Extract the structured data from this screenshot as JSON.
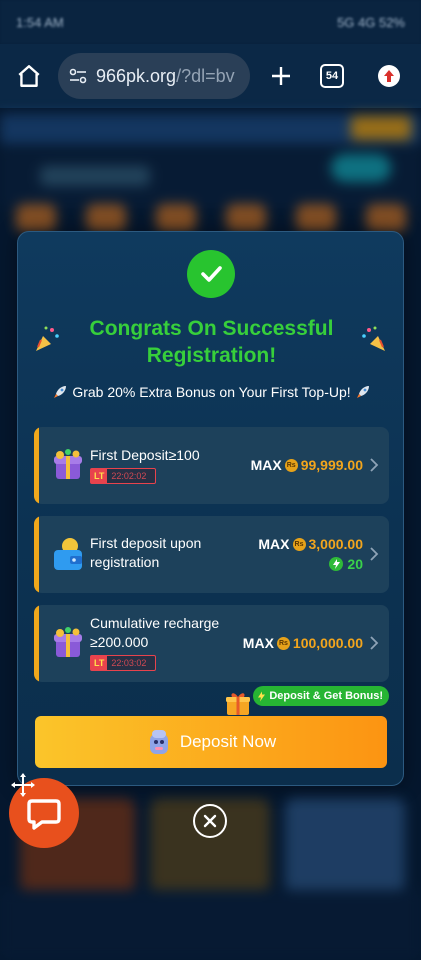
{
  "status_bar": {
    "time": "1:54 AM",
    "right": "5G 4G 52%"
  },
  "browser": {
    "url_main": "966pk.org",
    "url_rest": "/?dl=bv",
    "tab_count": "54"
  },
  "modal": {
    "title": "Congrats On Successful Registration!",
    "subtitle": "Grab 20% Extra Bonus on Your First Top-Up!",
    "offers": [
      {
        "title": "First Deposit≥100",
        "lt_label": "LT",
        "timer": "22:02:02",
        "max_label": "MAX",
        "currency": "Rs",
        "max_value": "99,999.00"
      },
      {
        "title_line1": "First deposit upon",
        "title_line2": "registration",
        "max_label": "MAX",
        "currency": "Rs",
        "max_value": "3,000.00",
        "bonus_value": "20"
      },
      {
        "title_line1": "Cumulative recharge",
        "title_line2": "≥200.000",
        "lt_label": "LT",
        "timer": "22:03:02",
        "max_label": "MAX",
        "currency": "Rs",
        "max_value": "100,000.00"
      }
    ],
    "deposit_tag": "Deposit & Get Bonus!",
    "deposit_button": "Deposit Now"
  },
  "colors": {
    "accent_green": "#37cf3b",
    "accent_orange": "#f2a51d",
    "modal_bg": "#0f3a5e",
    "chat_orange": "#e8501d"
  }
}
